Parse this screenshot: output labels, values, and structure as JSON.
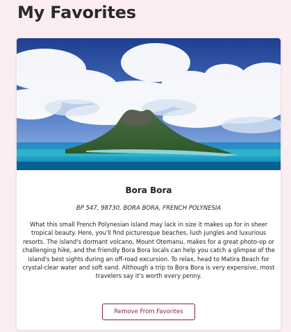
{
  "page": {
    "title": "My Favorites"
  },
  "favorites": [
    {
      "name": "Bora Bora",
      "address": "BP 547, 98730, BORA BORA, FRENCH POLYNESIA",
      "description": "What this small French Polynesian island may lack in size it makes up for in sheer tropical beauty. Here, you'll find picturesque beaches, lush jungles and luxurious resorts. The island's dormant volcano, Mount Otemanu, makes for a great photo-op or challenging hike, and the friendly Bora Bora locals can help you catch a glimpse of the island's best sights during an off-road excursion. To relax, head to Matira Beach for crystal-clear water and soft sand. Although a trip to Bora Bora is very expensive, most travelers say it's worth every penny.",
      "remove_label": "Remove From Favorites",
      "image_icon": "island-photo"
    }
  ],
  "colors": {
    "background": "#fbedf0",
    "accent": "#8b1d48"
  }
}
